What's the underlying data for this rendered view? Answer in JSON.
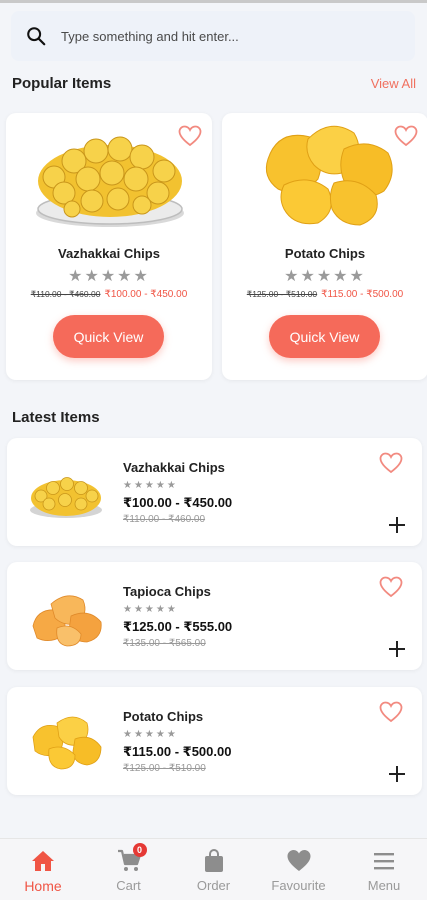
{
  "search": {
    "placeholder": "Type something and hit enter..."
  },
  "popular": {
    "title": "Popular Items",
    "view_all": "View All",
    "items": [
      {
        "name": "Vazhakkai Chips",
        "stars": "★★★★★",
        "old_price": "₹110.00 - ₹460.00",
        "new_price": "₹100.00 - ₹450.00",
        "button": "Quick View"
      },
      {
        "name": "Potato Chips",
        "stars": "★★★★★",
        "old_price": "₹125.00 - ₹510.00",
        "new_price": "₹115.00 - ₹500.00",
        "button": "Quick View"
      }
    ]
  },
  "latest": {
    "title": "Latest Items",
    "items": [
      {
        "name": "Vazhakkai Chips",
        "stars": "★★★★★",
        "price": "₹100.00 - ₹450.00",
        "old_price": "₹110.00 - ₹460.00"
      },
      {
        "name": "Tapioca Chips",
        "stars": "★★★★★",
        "price": "₹125.00 - ₹555.00",
        "old_price": "₹135.00 - ₹565.00"
      },
      {
        "name": "Potato Chips",
        "stars": "★★★★★",
        "price": "₹115.00 - ₹500.00",
        "old_price": "₹125.00 - ₹510.00"
      }
    ]
  },
  "nav": {
    "home": "Home",
    "cart": "Cart",
    "cart_count": "0",
    "order": "Order",
    "favourite": "Favourite",
    "menu": "Menu"
  },
  "colors": {
    "accent": "#f56a5a",
    "price_red": "#f05545",
    "background": "#f3f5f9"
  }
}
